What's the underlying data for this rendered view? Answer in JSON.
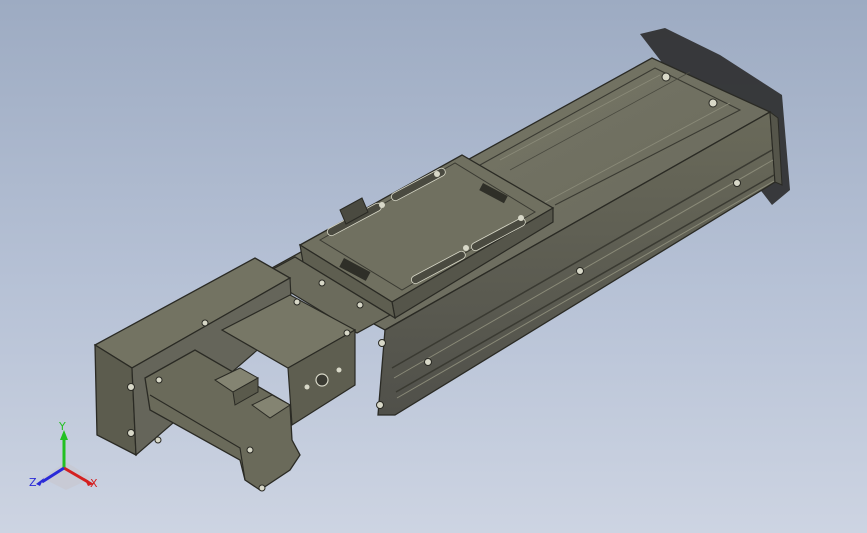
{
  "viewport": {
    "background_top": "#9dabc2",
    "background_bottom": "#cdd4e2",
    "model_color": "#6e6e5c"
  },
  "triad": {
    "y_label": "Y",
    "x_label": "X",
    "z_label": "Z",
    "y_color": "#23c023",
    "x_color": "#d42020",
    "z_color": "#2a2ad8"
  }
}
